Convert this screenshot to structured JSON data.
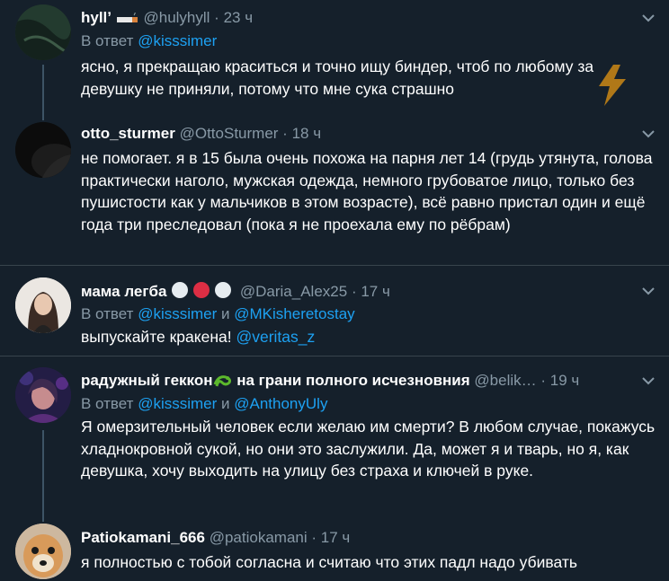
{
  "tweets": [
    {
      "name": "hyllʼ",
      "handle": "@hulyhyll",
      "dot": "·",
      "time": "23 ч",
      "reply_prefix": "В ответ",
      "reply_mention_1": "@kisssimer",
      "text": "ясно, я прекращаю краситься и точно ищу биндер, чтоб по любому за девушку не приняли, потому что мне сука страшно"
    },
    {
      "name": "otto_sturmer",
      "handle": "@OttoSturmer",
      "dot": "·",
      "time": "18 ч",
      "text": "не помогает. я в 15 была очень похожа на парня лет 14 (грудь утянута, голова практически наголо, мужская одежда, немного грубоватое лицо, только без пушистости как у мальчиков в этом возрасте), всё равно пристал один и ещё года три преследовал (пока я не проехала ему по рёбрам)"
    },
    {
      "name": "мама легба",
      "handle": "@Daria_Alex25",
      "dot": "·",
      "time": "17 ч",
      "reply_prefix": "В ответ",
      "reply_mention_1": "@kisssimer",
      "reply_and": "и",
      "reply_mention_2": "@MKisheretostay",
      "text": "выпускайте кракена!",
      "text_mention": "@veritas_z"
    },
    {
      "name_part1": "радужный геккон",
      "name_part2": "на грани полного исчезновния",
      "handle": "@belik…",
      "dot": "·",
      "time": "19 ч",
      "reply_prefix": "В ответ",
      "reply_mention_1": "@kisssimer",
      "reply_and": "и",
      "reply_mention_2": "@AnthonyUly",
      "text": "Я омерзительный человек если желаю им смерти? В любом случае, покажусь хладнокровной сукой, но они это заслужили. Да, может я и тварь, но я, как девушка, хочу выходить на улицу без страха и ключей в руке."
    },
    {
      "name": "Patiokamani_666",
      "handle": "@patiokamani",
      "dot": "·",
      "time": "17 ч",
      "text": "я полностью с тобой согласна и считаю что этих падл надо убивать"
    }
  ],
  "colors": {
    "background": "#15202b",
    "text": "#ffffff",
    "secondary": "#8899a6",
    "link": "#1da1f2",
    "separator": "#38444d",
    "thread_line": "#3d5466"
  },
  "icons": {
    "caret": "chevron-down-icon",
    "lightning": "lightning-icon",
    "cigarette": "cigarette-emoji-icon",
    "circles": "circle-emoji-icon",
    "lizard": "lizard-emoji-icon"
  }
}
